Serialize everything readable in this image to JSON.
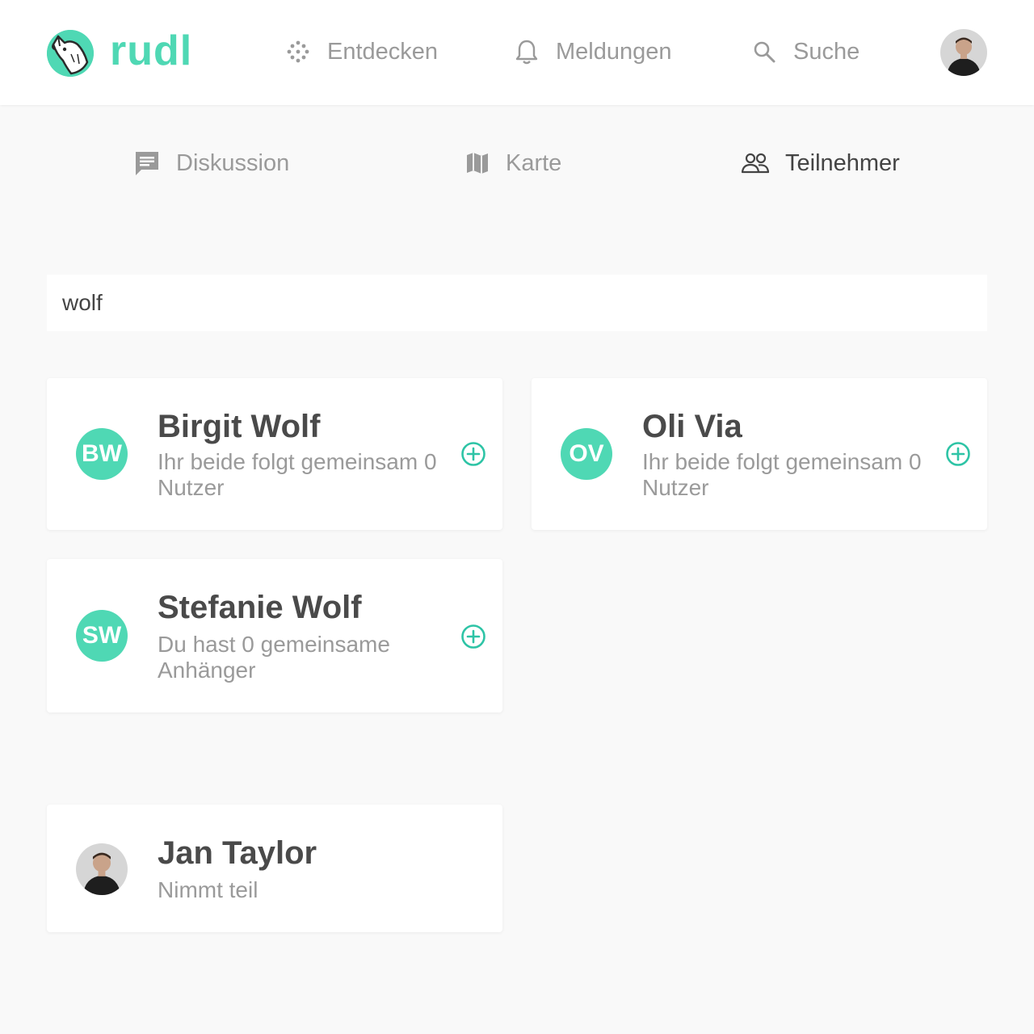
{
  "brand": {
    "name": "rudl",
    "color": "#4fd8b4"
  },
  "nav": {
    "discover": "Entdecken",
    "notifications": "Meldungen",
    "search": "Suche"
  },
  "tabs": {
    "discussion": "Diskussion",
    "map": "Karte",
    "participants": "Teilnehmer",
    "active": "participants"
  },
  "search_field": {
    "value": "wolf"
  },
  "results": [
    {
      "initials": "BW",
      "name": "Birgit Wolf",
      "subtitle": "Ihr beide folgt gemeinsam 0 Nutzer"
    },
    {
      "initials": "OV",
      "name": "Oli Via",
      "subtitle": "Ihr beide folgt gemeinsam 0 Nutzer"
    },
    {
      "initials": "SW",
      "name": "Stefanie Wolf",
      "subtitle": "Du hast 0 gemeinsame Anhänger"
    }
  ],
  "participant": {
    "name": "Jan Taylor",
    "subtitle": "Nimmt teil"
  },
  "icons": {
    "discover": "dots-grid-icon",
    "notifications": "bell-icon",
    "search": "search-icon",
    "discussion": "chat-icon",
    "map": "map-icon",
    "participants": "people-icon",
    "add": "plus-circle-icon"
  },
  "colors": {
    "accent": "#4fd8b4",
    "add_button": "#2ec4a6",
    "background": "#f9f9f9"
  }
}
